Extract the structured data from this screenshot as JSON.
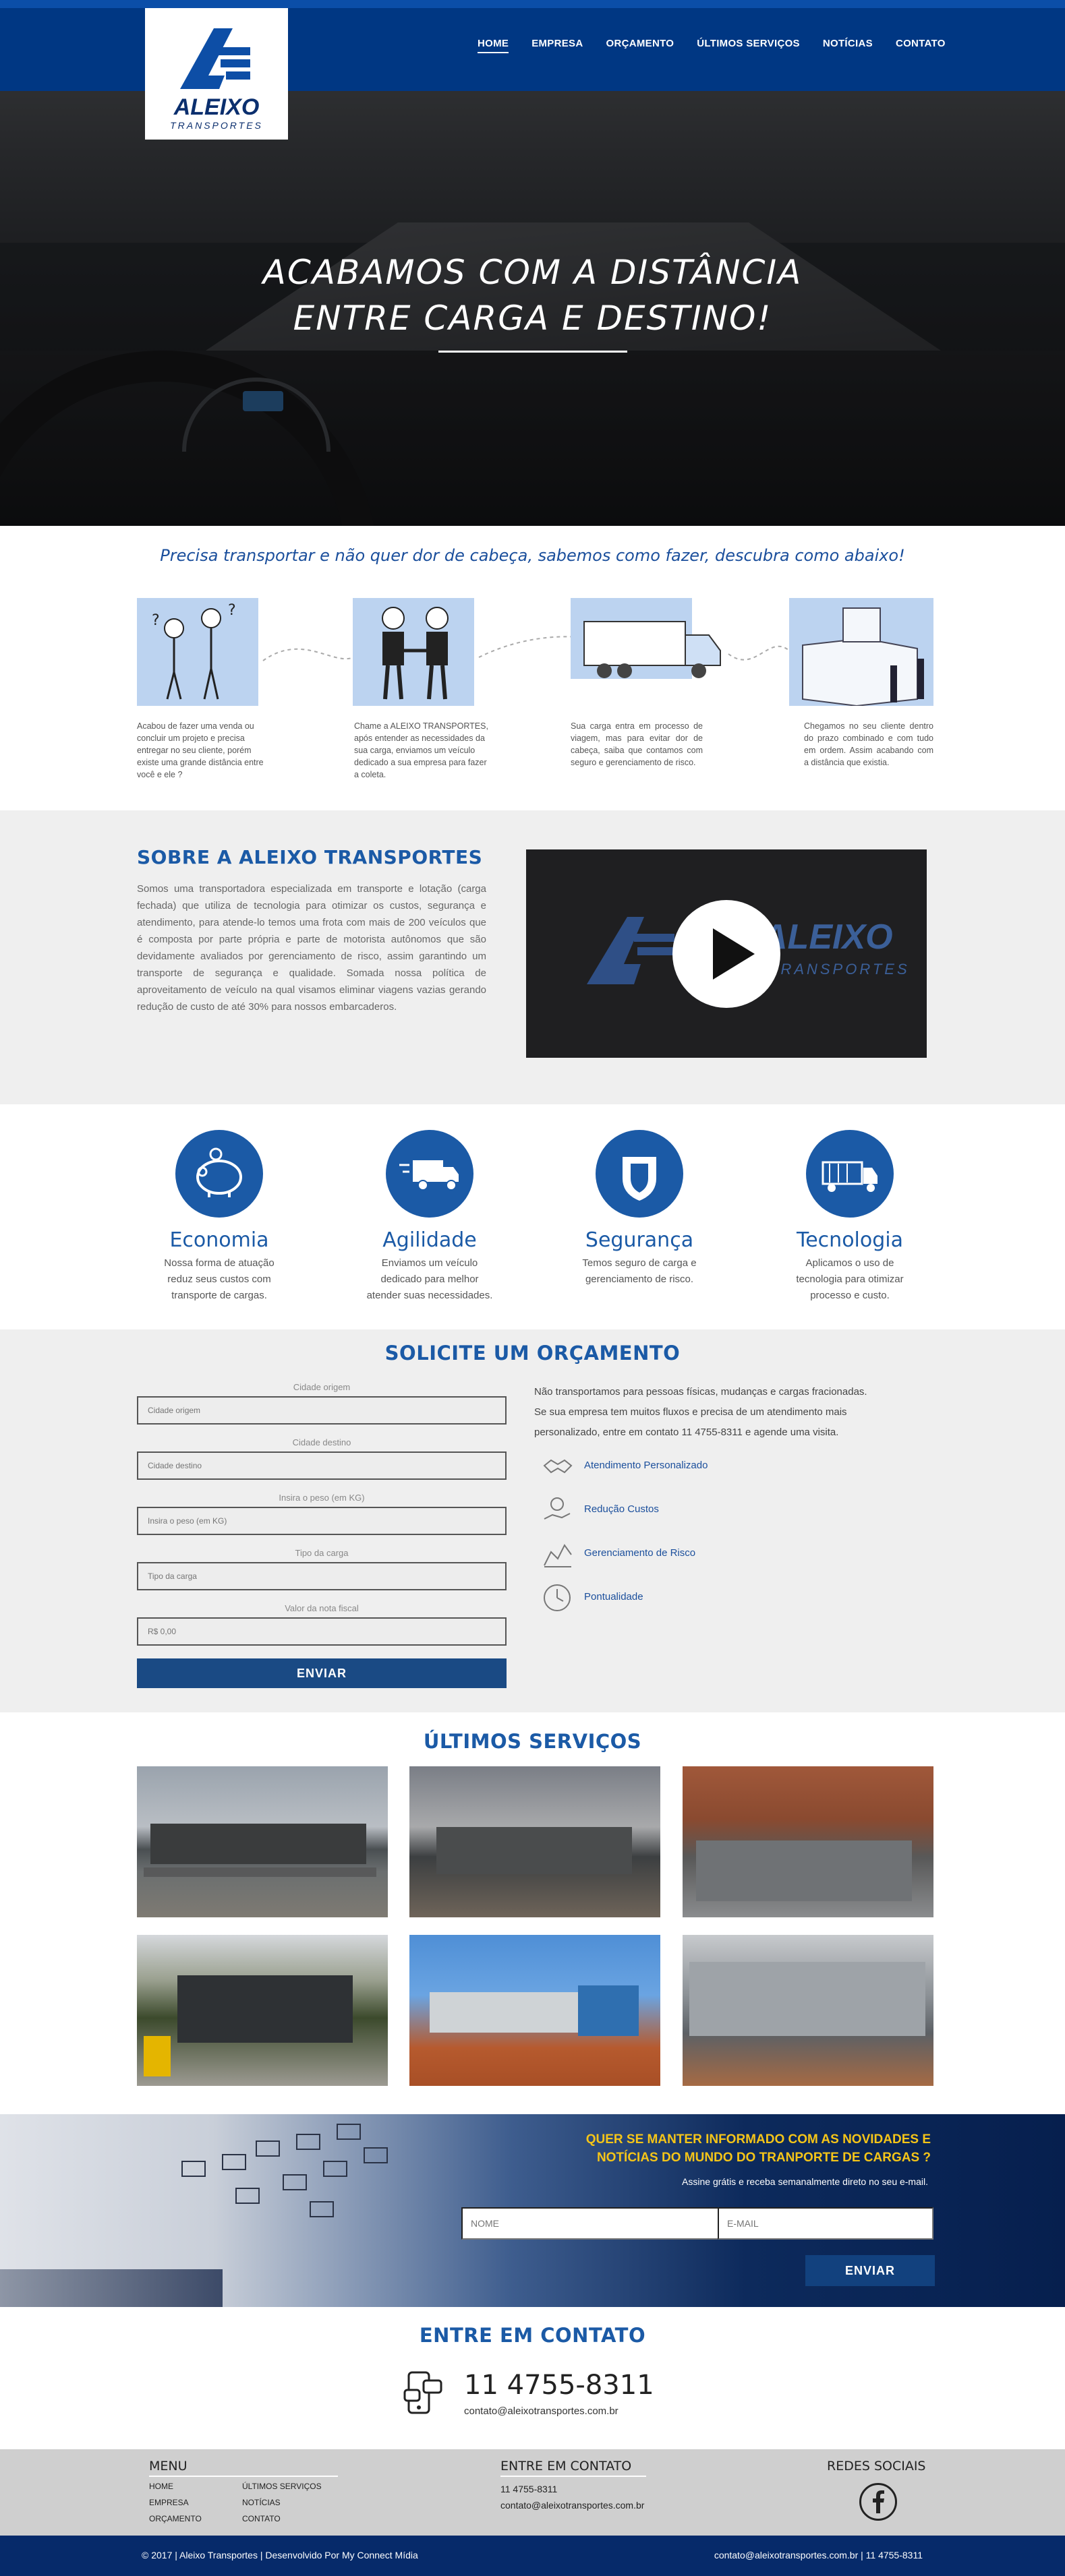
{
  "brand": {
    "logo_name": "ALEIXO",
    "logo_sub": "TRANSPORTES"
  },
  "nav": [
    {
      "label": "HOME",
      "active": true
    },
    {
      "label": "EMPRESA"
    },
    {
      "label": "ORÇAMENTO"
    },
    {
      "label": "ÚLTIMOS SERVIÇOS"
    },
    {
      "label": "NOTÍCIAS"
    },
    {
      "label": "CONTATO"
    }
  ],
  "hero": {
    "line1": "ACABAMOS COM A DISTÂNCIA",
    "line2": "ENTRE CARGA E DESTINO!"
  },
  "how": {
    "title": "Precisa transportar e não quer dor de cabeça, sabemos como fazer, descubra como abaixo!",
    "steps": [
      {
        "text": "Acabou de fazer uma venda ou concluir um projeto e precisa entregar no seu cliente, porém existe uma grande distância entre você e ele ?"
      },
      {
        "text": "Chame a ALEIXO TRANSPORTES, após entender as necessidades da sua carga, enviamos um veículo dedicado a sua empresa para fazer a coleta."
      },
      {
        "text": "Sua carga entra em processo de viagem, mas para evitar dor de cabeça, saiba que contamos com seguro e gerenciamento de risco."
      },
      {
        "text": "Chegamos no seu cliente dentro do prazo combinado e com tudo em ordem. Assim acabando com a distância que existia."
      }
    ]
  },
  "about": {
    "title": "SOBRE A ALEIXO TRANSPORTES",
    "text": "Somos uma transportadora especializada em transporte e lotação (carga fechada) que utiliza de tecnologia para otimizar os custos, segurança e atendimento, para atende-lo temos uma frota com mais de 200 veículos que é composta por parte própria e parte de motorista autônomos que são devidamente avaliados por gerenciamento de risco, assim garantindo um transporte de segurança e qualidade. Somada nossa política de aproveitamento de veículo na qual visamos eliminar viagens vazias gerando redução de custo de até 30% para nossos embarcaderos.",
    "video_logo": "ALEIXO",
    "video_sub": "TRANSPORTES"
  },
  "features": [
    {
      "title": "Economia",
      "text": "Nossa forma de atuação reduz seus custos com transporte de cargas.",
      "icon": "piggy-bank-icon"
    },
    {
      "title": "Agilidade",
      "text": "Enviamos um veículo dedicado para melhor atender suas necessidades.",
      "icon": "fast-truck-icon"
    },
    {
      "title": "Segurança",
      "text": "Temos seguro de carga e gerenciamento de risco.",
      "icon": "shield-icon"
    },
    {
      "title": "Tecnologia",
      "text": "Aplicamos o uso de tecnologia para otimizar processo e custo.",
      "icon": "truck-icon"
    }
  ],
  "quote": {
    "title": "SOLICITE UM ORÇAMENTO",
    "fields": [
      {
        "label": "Cidade origem",
        "placeholder": "Cidade origem"
      },
      {
        "label": "Cidade destino",
        "placeholder": "Cidade destino"
      },
      {
        "label": "Insira o peso (em KG)",
        "placeholder": "Insira o peso (em KG)"
      },
      {
        "label": "Tipo da carga",
        "placeholder": "Tipo da carga"
      },
      {
        "label": "Valor da nota fiscal",
        "placeholder": "R$ 0,00"
      }
    ],
    "submit": "ENVIAR",
    "info_line1": "Não transportamos para pessoas físicas, mudanças e cargas fracionadas.",
    "info_line2": "Se sua empresa tem muitos fluxos e precisa de um atendimento mais",
    "info_line3": "personalizado, entre em contato 11 4755-8311 e agende uma visita.",
    "benefits": [
      {
        "label": "Atendimento Personalizado",
        "icon": "handshake-icon"
      },
      {
        "label": "Redução Custos",
        "icon": "money-hand-icon"
      },
      {
        "label": "Gerenciamento de Risco",
        "icon": "chart-icon"
      },
      {
        "label": "Pontualidade",
        "icon": "clock-icon"
      }
    ]
  },
  "services": {
    "title": "ÚLTIMOS SERVIÇOS"
  },
  "newsletter": {
    "line1": "QUER SE MANTER INFORMADO COM AS NOVIDADES E",
    "line2": "NOTÍCIAS  DO MUNDO DO TRANPORTE DE CARGAS ?",
    "sub": "Assine grátis e receba semanalmente direto no seu e-mail.",
    "name_ph": "NOME",
    "email_ph": "E-MAIL",
    "submit": "ENVIAR"
  },
  "contact": {
    "title": "ENTRE EM CONTATO",
    "phone": "11 4755-8311",
    "email": "contato@aleixotransportes.com.br"
  },
  "footer": {
    "menu_title": "MENU",
    "menu": [
      "HOME",
      "ÚLTIMOS SERVIÇOS",
      "EMPRESA",
      "NOTÍCIAS",
      "ORÇAMENTO",
      "CONTATO"
    ],
    "contact_title": "ENTRE EM CONTATO",
    "phone": "11 4755-8311",
    "email": "contato@aleixotransportes.com.br",
    "social_title": "REDES SOCIAIS",
    "copyright": "© 2017 |  Aleixo Transportes | Desenvolvido Por My Connect Mídia",
    "bottom_right": "contato@aleixotransportes.com.br | 11 4755-8311"
  },
  "colors": {
    "brand_blue": "#1b5aa6",
    "nav_blue": "#003783",
    "dark_blue": "#062a6a",
    "newsletter_yellow": "#f5c518"
  }
}
